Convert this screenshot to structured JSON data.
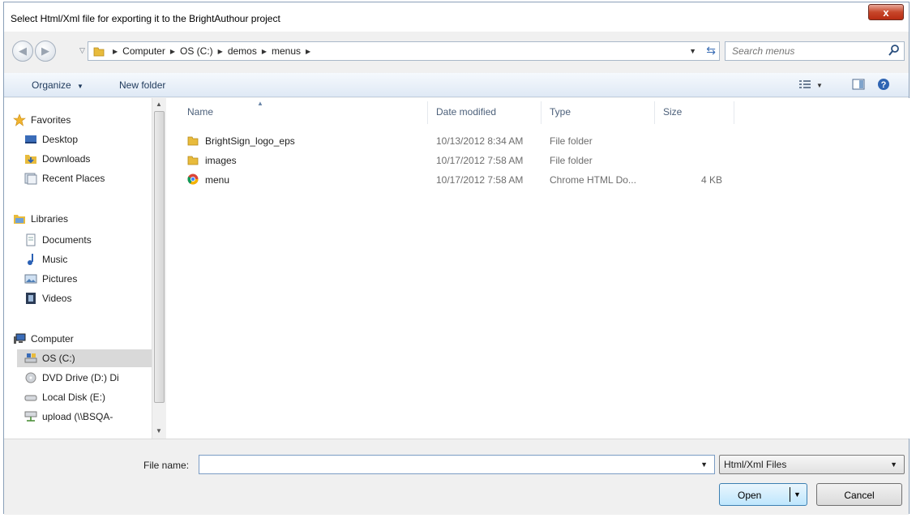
{
  "window": {
    "title": "Select Html/Xml file for exporting it to the BrightAuthour project",
    "close_label": "x"
  },
  "address": {
    "crumbs": [
      "Computer",
      "OS (C:)",
      "demos",
      "menus"
    ],
    "search_placeholder": "Search menus"
  },
  "toolbar": {
    "organize_label": "Organize",
    "new_folder_label": "New folder"
  },
  "nav": {
    "favorites": {
      "label": "Favorites",
      "items": [
        "Desktop",
        "Downloads",
        "Recent Places"
      ]
    },
    "libraries": {
      "label": "Libraries",
      "items": [
        "Documents",
        "Music",
        "Pictures",
        "Videos"
      ]
    },
    "computer": {
      "label": "Computer",
      "items": [
        "OS (C:)",
        "DVD Drive (D:) Di",
        "Local Disk (E:)",
        "upload (\\\\BSQA-"
      ]
    },
    "selected": "OS (C:)"
  },
  "columns": [
    "Name",
    "Date modified",
    "Type",
    "Size"
  ],
  "files": [
    {
      "name": "BrightSign_logo_eps",
      "date": "10/13/2012 8:34 AM",
      "type": "File folder",
      "size": "",
      "icon": "folder-icon"
    },
    {
      "name": "images",
      "date": "10/17/2012 7:58 AM",
      "type": "File folder",
      "size": "",
      "icon": "folder-icon"
    },
    {
      "name": "menu",
      "date": "10/17/2012 7:58 AM",
      "type": "Chrome HTML Do...",
      "size": "4 KB",
      "icon": "chrome-icon"
    }
  ],
  "bottom": {
    "file_name_label": "File name:",
    "file_name_value": "",
    "filter_value": "Html/Xml Files",
    "open_label": "Open",
    "cancel_label": "Cancel"
  },
  "colors": {
    "accent": "#3a6db5",
    "close_red": "#c7462a",
    "toolbar_bg": "#dfe9f5"
  }
}
